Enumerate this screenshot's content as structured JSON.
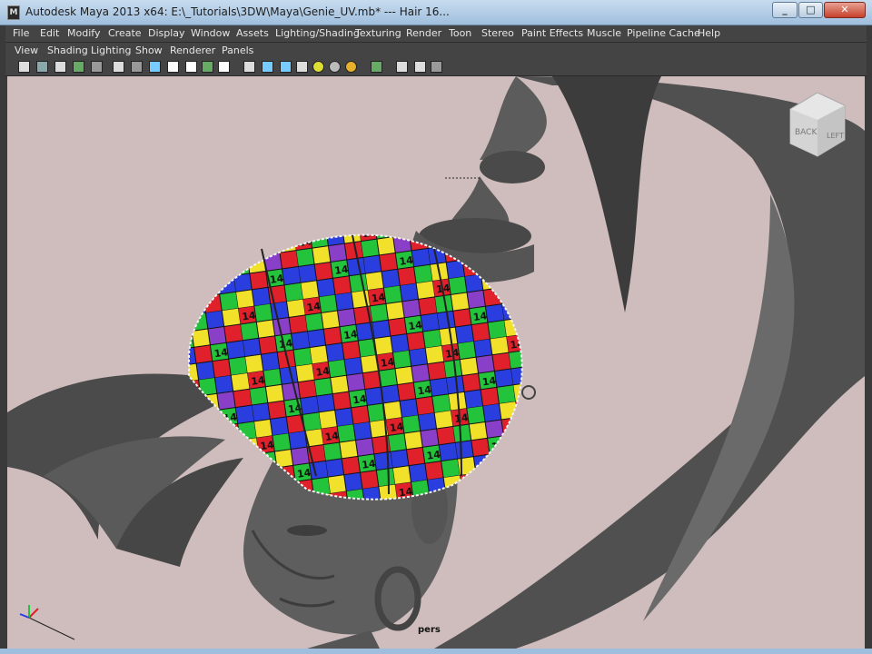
{
  "window": {
    "title": "Autodesk Maya 2013 x64: E:\\_Tutorials\\3DW\\Maya\\Genie_UV.mb*  ---  Hair 16...",
    "icon_label": "M",
    "minimize_icon": "minimize-icon",
    "maximize_icon": "maximize-icon",
    "close_icon": "close-icon"
  },
  "menubar": {
    "items": [
      "File",
      "Edit",
      "Modify",
      "Create",
      "Display",
      "Window",
      "Assets",
      "Lighting/Shading",
      "Texturing",
      "Render",
      "Toon",
      "Stereo",
      "Paint Effects",
      "Muscle",
      "Pipeline Cache",
      "Help"
    ]
  },
  "panel_menu": {
    "items": [
      "View",
      "Shading",
      "Lighting",
      "Show",
      "Renderer",
      "Panels"
    ]
  },
  "viewcube": {
    "back_label": "BACK",
    "side_label": "LEFT"
  },
  "viewport": {
    "camera_label": "pers",
    "colors": {
      "background": "#cebdbc",
      "model_gray": "#5a5a5a",
      "uv_red": "#e0202a",
      "uv_green": "#23c43b",
      "uv_blue": "#2a3ee0",
      "uv_yellow": "#f2e12a",
      "uv_purple": "#8a3fc8"
    },
    "uv_tile_label": "14"
  }
}
